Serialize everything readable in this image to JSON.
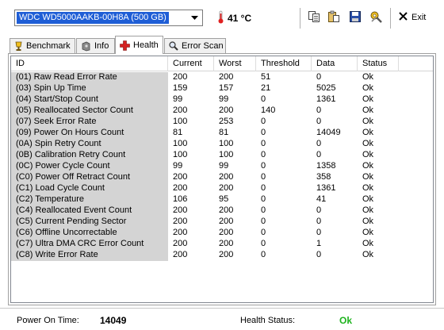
{
  "toolbar": {
    "drive": "WDC WD5000AAKB-00H8A (500 GB)",
    "temperature": "41 °C",
    "exit_label": "Exit",
    "icons": [
      "copy-icon",
      "paste-icon",
      "save-icon",
      "tools-icon",
      "close-icon"
    ]
  },
  "tabs": [
    {
      "label": "Benchmark",
      "icon": "benchmark-icon"
    },
    {
      "label": "Info",
      "icon": "info-icon"
    },
    {
      "label": "Health",
      "icon": "health-cross-icon",
      "active": true
    },
    {
      "label": "Error Scan",
      "icon": "magnifier-icon"
    }
  ],
  "table": {
    "columns": [
      "ID",
      "Current",
      "Worst",
      "Threshold",
      "Data",
      "Status"
    ],
    "rows": [
      {
        "id": "(01) Raw Read Error Rate",
        "current": "200",
        "worst": "200",
        "threshold": "51",
        "data": "0",
        "status": "Ok"
      },
      {
        "id": "(03) Spin Up Time",
        "current": "159",
        "worst": "157",
        "threshold": "21",
        "data": "5025",
        "status": "Ok"
      },
      {
        "id": "(04) Start/Stop Count",
        "current": "99",
        "worst": "99",
        "threshold": "0",
        "data": "1361",
        "status": "Ok"
      },
      {
        "id": "(05) Reallocated Sector Count",
        "current": "200",
        "worst": "200",
        "threshold": "140",
        "data": "0",
        "status": "Ok"
      },
      {
        "id": "(07) Seek Error Rate",
        "current": "100",
        "worst": "253",
        "threshold": "0",
        "data": "0",
        "status": "Ok"
      },
      {
        "id": "(09) Power On Hours Count",
        "current": "81",
        "worst": "81",
        "threshold": "0",
        "data": "14049",
        "status": "Ok"
      },
      {
        "id": "(0A) Spin Retry Count",
        "current": "100",
        "worst": "100",
        "threshold": "0",
        "data": "0",
        "status": "Ok"
      },
      {
        "id": "(0B) Calibration Retry Count",
        "current": "100",
        "worst": "100",
        "threshold": "0",
        "data": "0",
        "status": "Ok"
      },
      {
        "id": "(0C) Power Cycle Count",
        "current": "99",
        "worst": "99",
        "threshold": "0",
        "data": "1358",
        "status": "Ok"
      },
      {
        "id": "(C0) Power Off Retract Count",
        "current": "200",
        "worst": "200",
        "threshold": "0",
        "data": "358",
        "status": "Ok"
      },
      {
        "id": "(C1) Load Cycle Count",
        "current": "200",
        "worst": "200",
        "threshold": "0",
        "data": "1361",
        "status": "Ok"
      },
      {
        "id": "(C2) Temperature",
        "current": "106",
        "worst": "95",
        "threshold": "0",
        "data": "41",
        "status": "Ok"
      },
      {
        "id": "(C4) Reallocated Event Count",
        "current": "200",
        "worst": "200",
        "threshold": "0",
        "data": "0",
        "status": "Ok"
      },
      {
        "id": "(C5) Current Pending Sector",
        "current": "200",
        "worst": "200",
        "threshold": "0",
        "data": "0",
        "status": "Ok"
      },
      {
        "id": "(C6) Offline Uncorrectable",
        "current": "200",
        "worst": "200",
        "threshold": "0",
        "data": "0",
        "status": "Ok"
      },
      {
        "id": "(C7) Ultra DMA CRC Error Count",
        "current": "200",
        "worst": "200",
        "threshold": "0",
        "data": "1",
        "status": "Ok"
      },
      {
        "id": "(C8) Write Error Rate",
        "current": "200",
        "worst": "200",
        "threshold": "0",
        "data": "0",
        "status": "Ok"
      }
    ]
  },
  "statusbar": {
    "power_on_label": "Power On Time:",
    "power_on_value": "14049",
    "health_label": "Health Status:",
    "health_value": "Ok"
  },
  "colors": {
    "selection": "#1f5ed6",
    "health_ok": "#1db31d",
    "health_tab_cross": "#d42020",
    "thermometer": "#e02020",
    "id_column_bg": "#d4d4d4"
  }
}
